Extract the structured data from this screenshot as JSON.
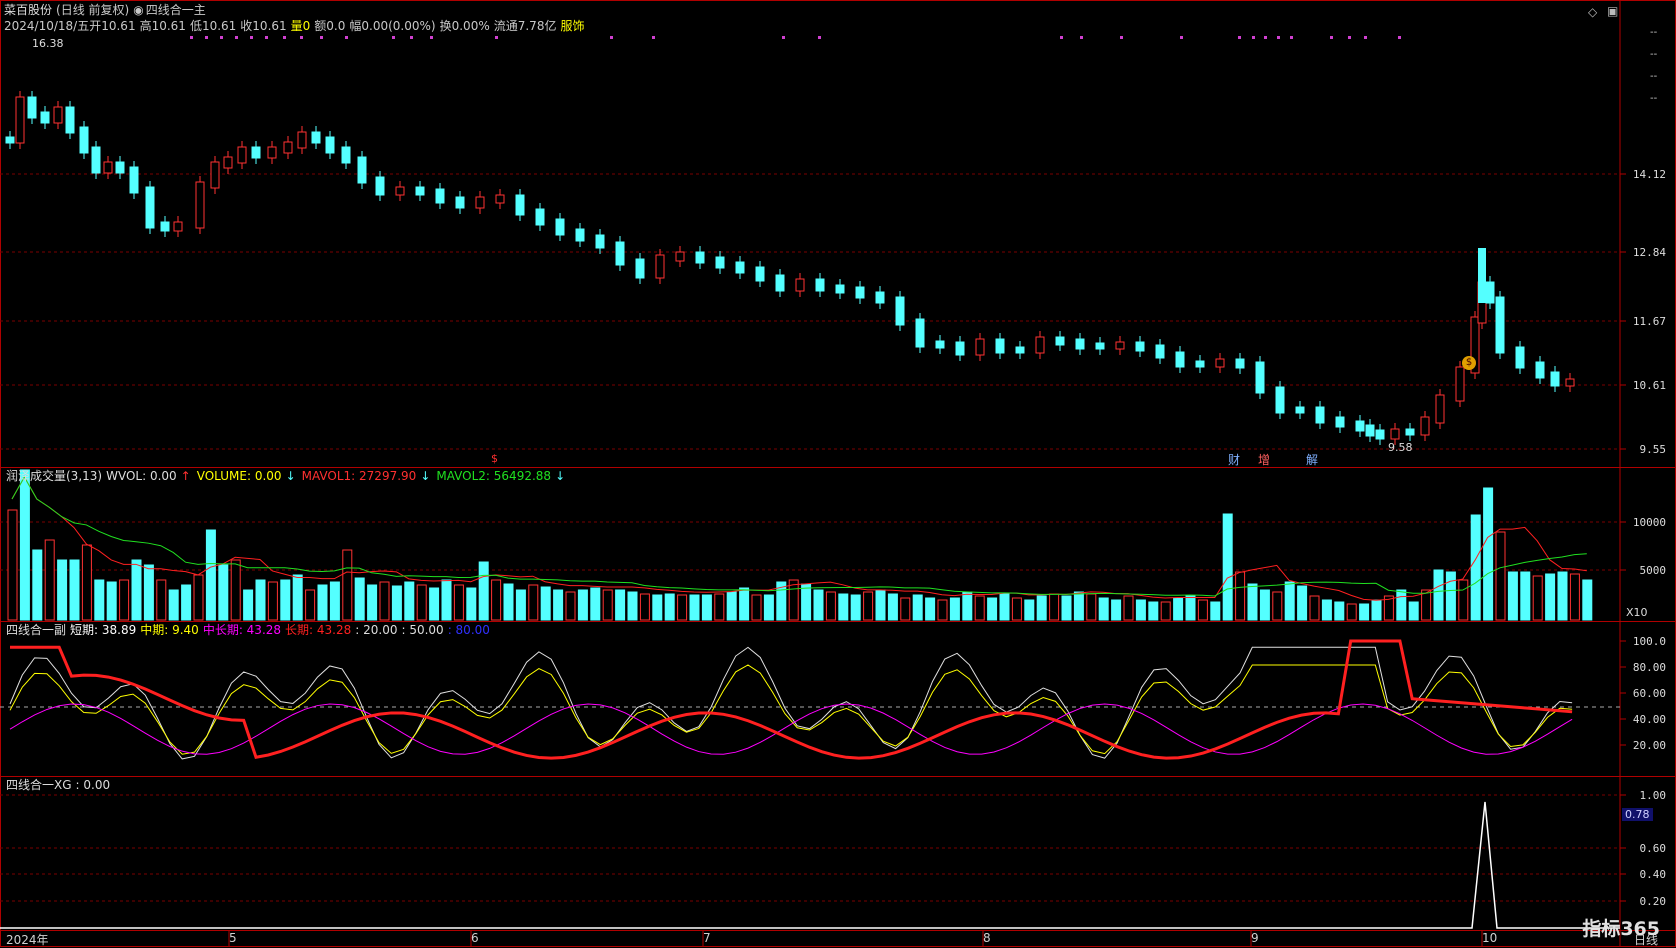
{
  "header": {
    "stock_name": "菜百股份",
    "period": "(日线 前复权)",
    "indicator_main": "四线合一主",
    "date": "2024/10/18/五",
    "open": "开10.61",
    "high": "高10.61",
    "low": "低10.61",
    "close": "收10.61",
    "volume": "量0",
    "amount": "额0.0",
    "change": "幅0.00(0.00%)",
    "turnover": "换0.00%",
    "float": "流通7.78亿",
    "sector": "服饰"
  },
  "price_panel": {
    "y_ticks": [
      "14.12",
      "12.84",
      "11.67",
      "10.61",
      "9.55"
    ],
    "high_marker": "16.38",
    "low_marker": "9.58",
    "event_tags": [
      {
        "text": "财",
        "color": "#7fb0ff"
      },
      {
        "text": "增",
        "color": "#ff6060"
      },
      {
        "text": "解",
        "color": "#7fb0ff"
      }
    ],
    "dollar_tag": "$",
    "coin_icon": "coin-icon"
  },
  "volume_panel": {
    "title": "润泽成交量(3,13)",
    "wvol": "WVOL: 0.00",
    "volume_label": "VOLUME: 0.00",
    "mavol1": "MAVOL1: 27297.90",
    "mavol2": "MAVOL2: 56492.88",
    "y_ticks": [
      "10000",
      "5000"
    ],
    "unit": "X10"
  },
  "sub_panel": {
    "title": "四线合一副",
    "short": "短期: 38.89",
    "mid": "中期: 9.40",
    "midlong": "中长期: 43.28",
    "long": "长期: 43.28",
    "l20": ": 20.00",
    "l50": ": 50.00",
    "l80": ": 80.00",
    "y_ticks": [
      "100.0",
      "80.00",
      "60.00",
      "40.00",
      "20.00"
    ]
  },
  "xg_panel": {
    "title": "四线合一XG",
    "value": ": 0.00",
    "y_ticks": [
      "1.00",
      "0.60",
      "0.40",
      "0.20"
    ],
    "current_box": "0.78"
  },
  "x_axis": {
    "labels": [
      "2024年",
      "5",
      "6",
      "7",
      "8",
      "9",
      "10"
    ],
    "period_label": "日线"
  },
  "watermark": "指标365",
  "colors": {
    "up": "#ff3232",
    "down": "#54ffff",
    "yellow": "#ffff00",
    "magenta": "#ff00ff",
    "grid_red": "#8b0000"
  }
}
